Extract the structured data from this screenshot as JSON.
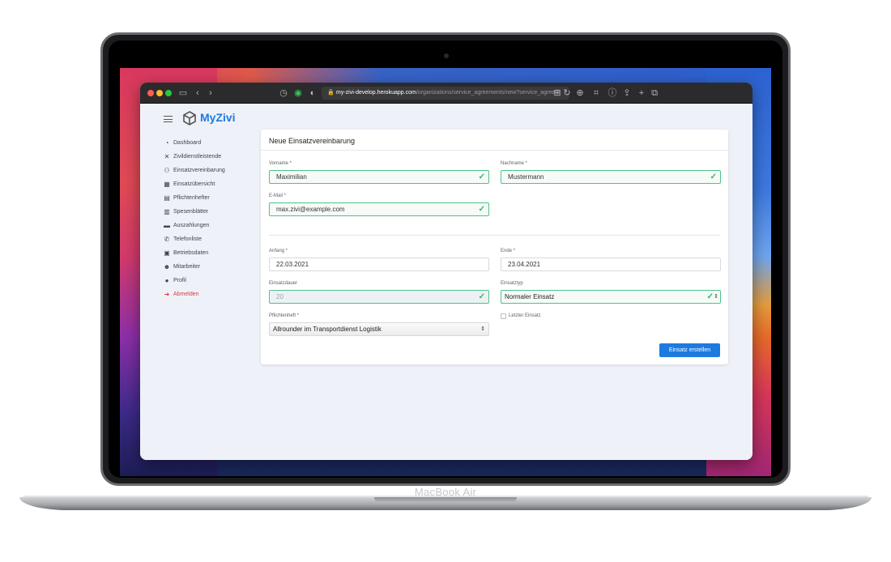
{
  "device": {
    "label": "MacBook Air"
  },
  "browser": {
    "domain": "my-zivi-develop.herokuapp.com",
    "path": "/organizations/service_agreements/new?service_agreem"
  },
  "app": {
    "brand": "MyZivi",
    "accent_color": "#1f7ae0"
  },
  "sidebar": {
    "items": [
      {
        "label": "Dashboard",
        "icon": "chart-pie-icon",
        "glyph": "◔"
      },
      {
        "label": "Zivildienstleistende",
        "icon": "tools-icon",
        "glyph": "✕"
      },
      {
        "label": "Einsatzvereinbarung",
        "icon": "handshake-icon",
        "glyph": "⚇"
      },
      {
        "label": "Einsatzübersicht",
        "icon": "calendar-icon",
        "glyph": "▦"
      },
      {
        "label": "Pflichtenhefter",
        "icon": "document-icon",
        "glyph": "▤"
      },
      {
        "label": "Spesenblätter",
        "icon": "receipt-icon",
        "glyph": "▥"
      },
      {
        "label": "Auszahlungen",
        "icon": "folder-icon",
        "glyph": "▬"
      },
      {
        "label": "Telefonliste",
        "icon": "phone-icon",
        "glyph": "✆"
      },
      {
        "label": "Betriebsdaten",
        "icon": "archive-icon",
        "glyph": "▣"
      },
      {
        "label": "Mitarbeiter",
        "icon": "users-icon",
        "glyph": "☻"
      },
      {
        "label": "Profil",
        "icon": "user-icon",
        "glyph": "●"
      },
      {
        "label": "Abmelden",
        "icon": "logout-icon",
        "glyph": "➜"
      }
    ]
  },
  "form": {
    "title": "Neue Einsatzvereinbarung",
    "first_name": {
      "label": "Vorname *",
      "value": "Maximilian"
    },
    "last_name": {
      "label": "Nachname *",
      "value": "Mustermann"
    },
    "email": {
      "label": "E-Mail *",
      "value": "max.zivi@example.com"
    },
    "start": {
      "label": "Anfang *",
      "value": "22.03.2021"
    },
    "end": {
      "label": "Ende *",
      "value": "23.04.2021"
    },
    "duration": {
      "label": "Einsatzdauer",
      "value": "20"
    },
    "type": {
      "label": "Einsatztyp",
      "value": "Normaler Einsatz"
    },
    "specification": {
      "label": "Pflichtenheft *",
      "value": "Allrounder im Transportdienst Logistik"
    },
    "last_service": {
      "label": "Letzter Einsatz",
      "checked": false
    },
    "submit_label": "Einsatz erstellen"
  }
}
